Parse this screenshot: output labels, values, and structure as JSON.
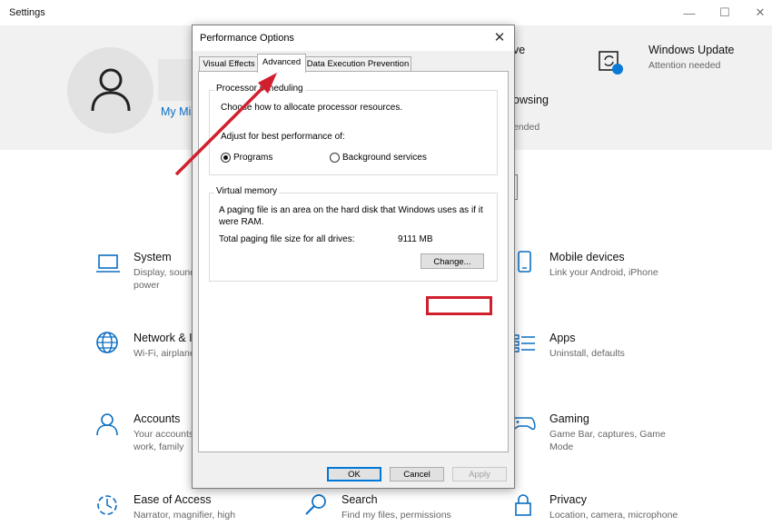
{
  "settings": {
    "app_title": "Settings",
    "account_link": "My Mi",
    "hero_items": [
      {
        "title": "ve",
        "subtitle": ""
      },
      {
        "title": "owsing",
        "subtitle": "ended"
      }
    ],
    "windows_update": {
      "title": "Windows Update",
      "subtitle": "Attention needed"
    },
    "tiles": [
      {
        "title": "System",
        "subtitle": "Display, sound\npower",
        "icon": "laptop-icon"
      },
      {
        "title": "Mobile devices",
        "subtitle": "Link your Android, iPhone",
        "icon": "phone-icon"
      },
      {
        "title": "Network & In",
        "subtitle": "Wi-Fi, airplane",
        "icon": "globe-icon"
      },
      {
        "title": "Apps",
        "subtitle": "Uninstall, defaults",
        "icon": "apps-list-icon"
      },
      {
        "title": "Accounts",
        "subtitle": "Your accounts,\nwork, family",
        "icon": "person-icon"
      },
      {
        "title": "Gaming",
        "subtitle": "Game Bar, captures, Game\nMode",
        "icon": "gamepad-icon"
      },
      {
        "title": "Ease of Access",
        "subtitle": "Narrator, magnifier, high",
        "icon": "ease-of-access-icon"
      },
      {
        "title": "Search",
        "subtitle": "Find my files, permissions",
        "icon": "search-icon"
      },
      {
        "title": "Privacy",
        "subtitle": "Location, camera, microphone",
        "icon": "lock-icon"
      }
    ]
  },
  "dialog": {
    "title": "Performance Options",
    "tabs": [
      "Visual Effects",
      "Advanced",
      "Data Execution Prevention"
    ],
    "active_tab": "Advanced",
    "processor": {
      "group_label": "Processor scheduling",
      "description": "Choose how to allocate processor resources.",
      "adjust_label": "Adjust for best performance of:",
      "option_programs": "Programs",
      "option_background": "Background services",
      "selected": "Programs"
    },
    "virtual_memory": {
      "group_label": "Virtual memory",
      "description_line1": "A paging file is an area on the hard disk that Windows uses as if it",
      "description_line2": "were RAM.",
      "total_label": "Total paging file size for all drives:",
      "total_value": "9111 MB",
      "change_button": "Change..."
    },
    "buttons": {
      "ok": "OK",
      "cancel": "Cancel",
      "apply": "Apply"
    }
  },
  "annotation": {
    "highlight_color": "#d0202e",
    "arrow_color": "#d0202e"
  }
}
